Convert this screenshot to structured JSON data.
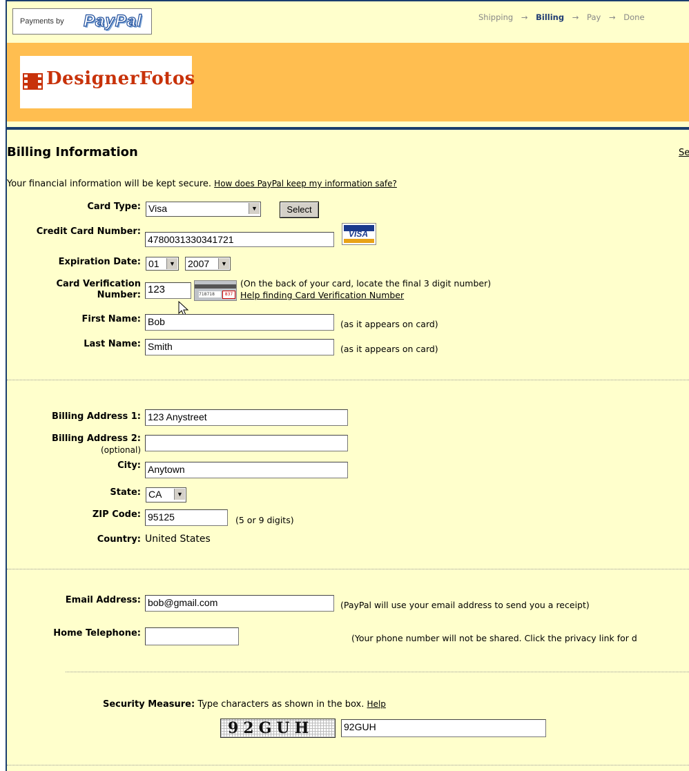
{
  "header": {
    "payments_by": "Payments by",
    "paypal_logo": "PayPal",
    "steps": [
      "Shipping",
      "Billing",
      "Pay",
      "Done"
    ],
    "step_arrow": "→",
    "current_step": "Billing",
    "merchant_logo": "DesignerFotos"
  },
  "page": {
    "title": "Billing Information",
    "top_right_link": "Se",
    "secure_text": "Your financial information will be kept secure.",
    "secure_link": "How does PayPal keep my information safe?"
  },
  "card": {
    "card_type_label": "Card Type:",
    "card_type_value": "Visa",
    "select_button": "Select",
    "number_label": "Credit Card Number:",
    "number_value": "4780031330341721",
    "card_logo": "VISA",
    "expiration_label": "Expiration Date:",
    "exp_month": "01",
    "exp_year": "2007",
    "cvv_label_1": "Card Verification",
    "cvv_label_2": "Number:",
    "cvv_value": "123",
    "cvv_image_number": "718718",
    "cvv_image_code": "837",
    "cvv_note": "(On the back of your card, locate the final 3 digit number)",
    "cvv_help_link": "Help finding Card Verification Number",
    "first_name_label": "First Name:",
    "first_name_value": "Bob",
    "last_name_label": "Last Name:",
    "last_name_value": "Smith",
    "as_on_card": "(as it appears on card)"
  },
  "address": {
    "addr1_label": "Billing Address 1:",
    "addr1_value": "123 Anystreet",
    "addr2_label": "Billing Address 2:",
    "addr2_optional": "(optional)",
    "addr2_value": "",
    "city_label": "City:",
    "city_value": "Anytown",
    "state_label": "State:",
    "state_value": "CA",
    "zip_label": "ZIP Code:",
    "zip_value": "95125",
    "zip_note": "(5 or 9 digits)",
    "country_label": "Country:",
    "country_value": "United States"
  },
  "contact": {
    "email_label": "Email Address:",
    "email_value": "bob@gmail.com",
    "email_note": "(PayPal will use your email address to send you a receipt)",
    "phone_label": "Home Telephone:",
    "phone_value": "",
    "phone_note": "(Your phone number will not be shared. Click the privacy link for d"
  },
  "security": {
    "label": "Security Measure:",
    "instruction": "Type characters as shown in the box.",
    "help_link": "Help",
    "captcha_text": "92GUH",
    "captcha_value": "92GUH"
  },
  "colors": {
    "background": "#FFFFCC",
    "orange_band": "#FFBE50",
    "border_blue": "#1A3E6E",
    "logo_red": "#C8320A"
  }
}
